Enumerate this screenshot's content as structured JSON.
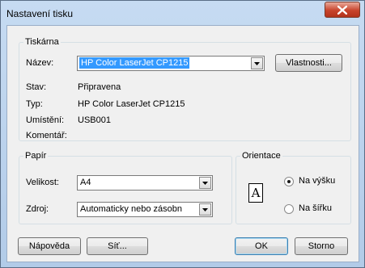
{
  "window": {
    "title": "Nastavení tisku"
  },
  "printer": {
    "group_label": "Tiskárna",
    "name_label": "Název:",
    "name_value": "HP Color LaserJet CP1215",
    "properties_label": "Vlastnosti...",
    "status_label": "Stav:",
    "status_value": "Připravena",
    "type_label": "Typ:",
    "type_value": "HP Color LaserJet CP1215",
    "location_label": "Umístění:",
    "location_value": "USB001",
    "comment_label": "Komentář:"
  },
  "paper": {
    "group_label": "Papír",
    "size_label": "Velikost:",
    "size_value": "A4",
    "source_label": "Zdroj:",
    "source_value": "Automaticky nebo zásobn"
  },
  "orientation": {
    "group_label": "Orientace",
    "portrait_label": "Na výšku",
    "landscape_label": "Na šířku",
    "selected": "portrait",
    "icon_letter": "A"
  },
  "buttons": {
    "help": "Nápověda",
    "network": "Síť...",
    "ok": "OK",
    "cancel": "Storno"
  }
}
